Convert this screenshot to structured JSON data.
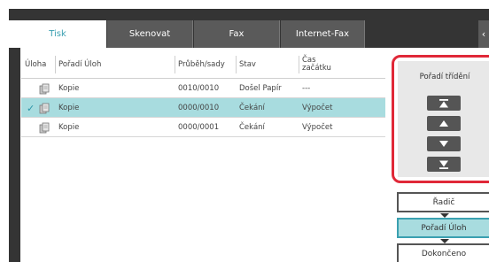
{
  "tabs": [
    {
      "label": "Tisk",
      "active": true
    },
    {
      "label": "Skenovat",
      "active": false
    },
    {
      "label": "Fax",
      "active": false
    },
    {
      "label": "Internet-Fax",
      "active": false
    }
  ],
  "table": {
    "headers": {
      "job": "Úloha",
      "order": "Pořadí Úloh",
      "progress": "Průběh/sady",
      "status": "Stav",
      "start_line1": "Čas",
      "start_line2": "začátku"
    },
    "rows": [
      {
        "name": "Kopie",
        "progress": "0010/0010",
        "status": "Došel Papír",
        "start": "---",
        "selected": false
      },
      {
        "name": "Kopie",
        "progress": "0000/0010",
        "status": "Čekání",
        "start": "Výpočet",
        "selected": true
      },
      {
        "name": "Kopie",
        "progress": "0000/0001",
        "status": "Čekání",
        "start": "Výpočet",
        "selected": false
      }
    ]
  },
  "sort_panel": {
    "title": "Pořadí třídění",
    "buttons": [
      "move-to-top",
      "move-up",
      "move-down",
      "move-to-bottom"
    ]
  },
  "side_buttons": {
    "controller": "Řadič",
    "job_order": "Pořadí Úloh",
    "completed": "Dokončeno"
  },
  "colors": {
    "accent": "#3a9fb1",
    "selection": "#a8dcdf",
    "highlight_frame": "#e02838",
    "dark_bg": "#343434"
  }
}
